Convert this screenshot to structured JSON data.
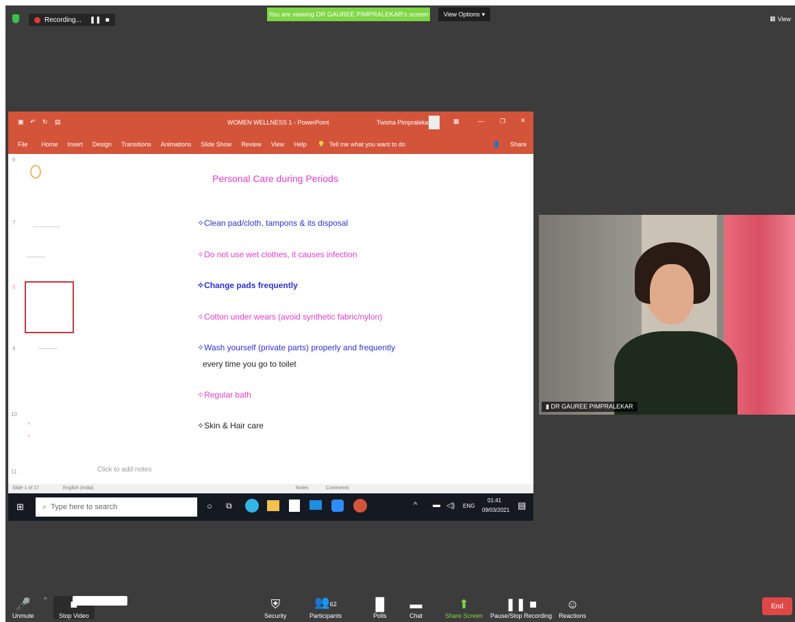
{
  "top": {
    "recording_label": "Recording...",
    "banner": "You are viewing DR GAUREE PIMPRALEKAR's screen",
    "view_options": "View Options",
    "view": "View"
  },
  "ppt": {
    "title": "WOMEN WELLNESS 1 - PowerPoint",
    "user": "Twisha Pimpralekar",
    "menu": [
      "File",
      "Home",
      "Insert",
      "Design",
      "Transitions",
      "Animations",
      "Slide Show",
      "Review",
      "View",
      "Help"
    ],
    "tell_me": "Tell me what you want to do",
    "share": "Share",
    "thumb_numbers": [
      "6",
      "7",
      "8",
      "9",
      "10",
      "11"
    ],
    "slide": {
      "title": "Personal Care during Periods",
      "bullets": [
        "Clean pad/cloth, tampons & its disposal",
        "Do not use wet clothes, it causes infection",
        "Change pads frequently",
        "Cotton under wears (avoid synthetic fabric/nylon)",
        "Wash yourself (private parts) properly and frequently",
        "every time you go to toilet",
        "Regular bath",
        "Skin & Hair care"
      ]
    },
    "notes_placeholder": "Click to add notes",
    "status_slide": "Slide 1 of 17",
    "status_lang": "English (India)",
    "notes_label": "Notes",
    "comments_label": "Comments"
  },
  "taskbar": {
    "search_placeholder": "Type here to search",
    "lang": "ENG",
    "time": "01:41",
    "date": "09/03/2021"
  },
  "participant": {
    "name": "DR GAUREE PIMPRALEKAR"
  },
  "controls": {
    "unmute": "Unmute",
    "stop_video": "Stop Video",
    "security": "Security",
    "participants": "Participants",
    "participants_count": "62",
    "polls": "Polls",
    "chat": "Chat",
    "share_screen": "Share Screen",
    "pause_recording": "Pause/Stop Recording",
    "reactions": "Reactions",
    "end": "End"
  },
  "colors": {
    "accent_ppt": "#d4543a",
    "magenta": "#e23bcd",
    "blue": "#2b31d8",
    "banner_green": "#7fd646"
  }
}
